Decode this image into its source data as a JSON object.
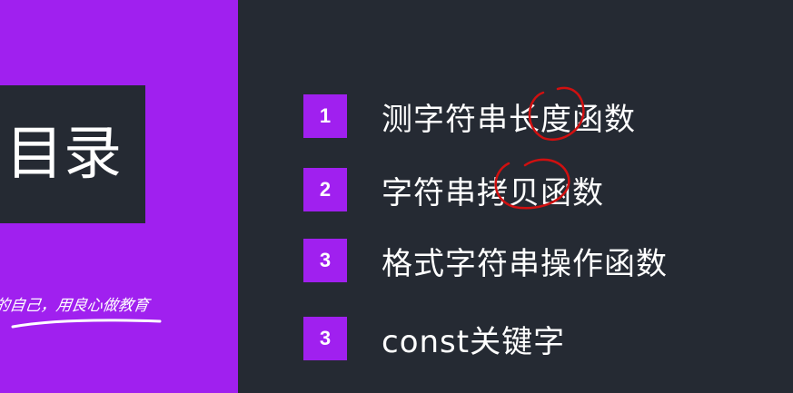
{
  "sidebar": {
    "title": "目录",
    "slogan": "的自己，用良心做教育"
  },
  "toc": {
    "items": [
      {
        "number": "1",
        "label": "测字符串长度函数"
      },
      {
        "number": "2",
        "label": "字符串拷贝函数"
      },
      {
        "number": "3",
        "label": "格式字符串操作函数"
      },
      {
        "number": "3",
        "label": "const关键字"
      }
    ]
  },
  "colors": {
    "accent": "#a020ef",
    "background": "#252a33",
    "annotation": "#d01010"
  }
}
